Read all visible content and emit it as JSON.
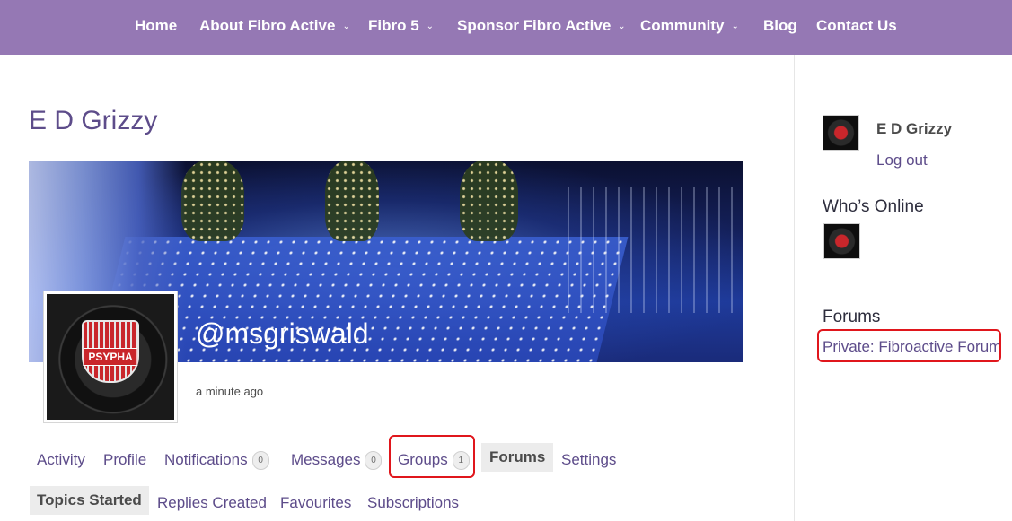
{
  "nav": {
    "items": [
      {
        "label": "Home",
        "has_dropdown": false
      },
      {
        "label": "About Fibro Active",
        "has_dropdown": true
      },
      {
        "label": "Fibro 5",
        "has_dropdown": true
      },
      {
        "label": "Sponsor Fibro Active",
        "has_dropdown": true
      },
      {
        "label": "Community",
        "has_dropdown": true
      },
      {
        "label": "Blog",
        "has_dropdown": false
      },
      {
        "label": "Contact Us",
        "has_dropdown": false
      }
    ],
    "chevron": "⌄"
  },
  "profile": {
    "title": "E D Grizzy",
    "handle": "@msgriswald",
    "last_active": "a minute ago",
    "avatar_text": "PSYPHA"
  },
  "subnav": {
    "items": [
      {
        "label": "Activity",
        "count": null,
        "current": false
      },
      {
        "label": "Profile",
        "count": null,
        "current": false
      },
      {
        "label": "Notifications",
        "count": "0",
        "current": false
      },
      {
        "label": "Messages",
        "count": "0",
        "current": false
      },
      {
        "label": "Groups",
        "count": "1",
        "current": false
      },
      {
        "label": "Forums",
        "count": null,
        "current": true
      },
      {
        "label": "Settings",
        "count": null,
        "current": false
      }
    ]
  },
  "forum_tabs": {
    "items": [
      {
        "label": "Topics Started",
        "current": true
      },
      {
        "label": "Replies Created",
        "current": false
      },
      {
        "label": "Favourites",
        "current": false
      },
      {
        "label": "Subscriptions",
        "current": false
      }
    ]
  },
  "sidebar": {
    "user_name": "E D Grizzy",
    "logout_label": "Log out",
    "whos_online_heading": "Who’s Online",
    "forums_heading": "Forums",
    "forum_link": "Private: Fibroactive Forum"
  },
  "colors": {
    "nav_bg": "#9578b4",
    "link": "#5d4c8a",
    "highlight": "#e0161c"
  }
}
